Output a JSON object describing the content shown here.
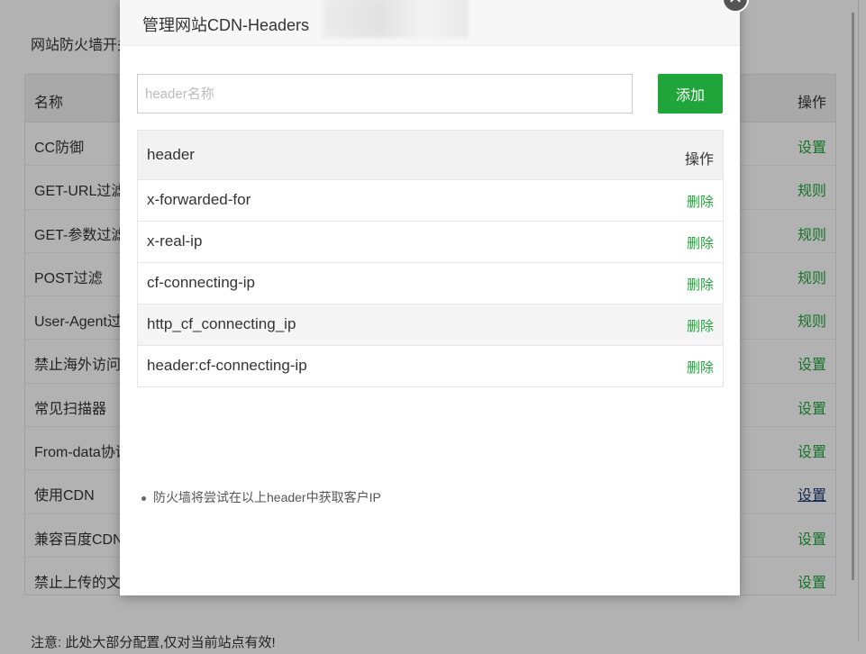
{
  "background": {
    "heading": "网站防火墙开关",
    "table_header": {
      "name": "名称",
      "action": "操作"
    },
    "rows": [
      {
        "name": "CC防御",
        "action": "设置"
      },
      {
        "name": "GET-URL过滤",
        "action": "规则"
      },
      {
        "name": "GET-参数过滤",
        "action": "规则"
      },
      {
        "name": "POST过滤",
        "action": "规则"
      },
      {
        "name": "User-Agent过滤",
        "action": "规则"
      },
      {
        "name": "禁止海外访问",
        "action": "设置"
      },
      {
        "name": "常见扫描器",
        "action": "设置"
      },
      {
        "name": "From-data协议",
        "action": "设置"
      },
      {
        "name": "使用CDN",
        "action": "设置"
      },
      {
        "name": "兼容百度CDN",
        "action": "设置"
      },
      {
        "name": "禁止上传的文件",
        "action": "设置"
      }
    ],
    "footnote": "注意: 此处大部分配置,仅对当前站点有效!"
  },
  "modal": {
    "title": "管理网站CDN-Headers",
    "close_glyph": "✕",
    "input_placeholder": "header名称",
    "input_value": "",
    "add_label": "添加",
    "table_header": {
      "header": "header",
      "action": "操作"
    },
    "rows": [
      {
        "header": "x-forwarded-for",
        "action": "删除"
      },
      {
        "header": "x-real-ip",
        "action": "删除"
      },
      {
        "header": "cf-connecting-ip",
        "action": "删除"
      },
      {
        "header": "http_cf_connecting_ip",
        "action": "删除"
      },
      {
        "header": "header:cf-connecting-ip",
        "action": "删除"
      }
    ],
    "tip": "防火墙将尝试在以上header中获取客户IP"
  },
  "colors": {
    "accent": "#20a53a",
    "overlay": "rgba(0,0,0,0.30)"
  }
}
